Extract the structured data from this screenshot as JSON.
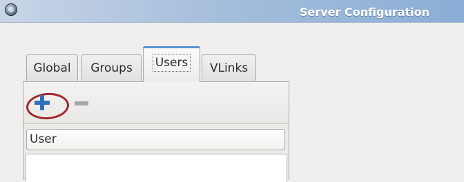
{
  "window": {
    "title": "Server Configuration",
    "icon": "app-orb-icon"
  },
  "tabs": [
    {
      "label": "Global",
      "active": false
    },
    {
      "label": "Groups",
      "active": false
    },
    {
      "label": "Users",
      "active": true
    },
    {
      "label": "VLinks",
      "active": false
    }
  ],
  "toolbar": {
    "add_icon": "plus-icon",
    "remove_icon": "minus-icon",
    "highlight_color": "#a0272d",
    "add_color": "#2f6fb8"
  },
  "users_list": {
    "header": "User",
    "items": []
  }
}
